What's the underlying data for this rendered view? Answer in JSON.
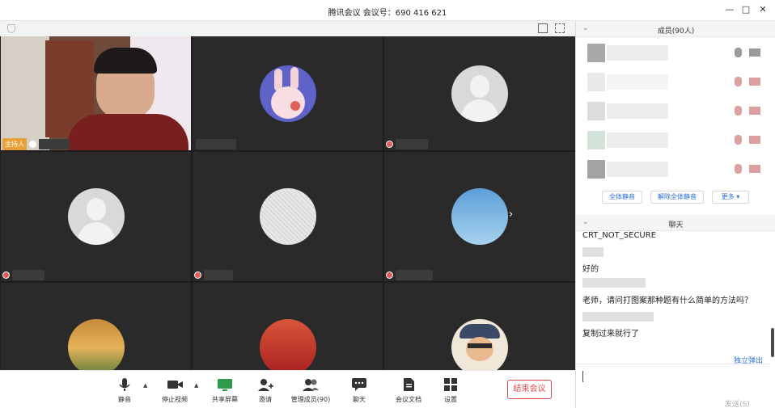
{
  "window": {
    "title": "腾讯会议 会议号：690 416 621",
    "controls": [
      "—",
      "□",
      "✕"
    ]
  },
  "video": {
    "tiles": [
      {
        "kind": "camera",
        "host_tag": "主持人"
      },
      {
        "kind": "bunny"
      },
      {
        "kind": "default"
      },
      {
        "kind": "default"
      },
      {
        "kind": "pattern"
      },
      {
        "kind": "sky"
      },
      {
        "kind": "sunset"
      },
      {
        "kind": "red"
      },
      {
        "kind": "cartoon"
      }
    ],
    "next_page_icon": "chevron-right-icon"
  },
  "toolbar": {
    "mute_label": "静音",
    "stop_video_label": "停止视频",
    "share_screen_label": "共享屏幕",
    "invite_label": "邀请",
    "manage_members_label": "管理成员(90)",
    "chat_label": "聊天",
    "meeting_docs_label": "会议文档",
    "settings_label": "设置",
    "end_meeting_label": "结束会议"
  },
  "members_panel": {
    "title": "成员(90人)",
    "rows": [
      {
        "mic": "on",
        "cam": "on"
      },
      {
        "mic": "muted",
        "cam": "muted"
      },
      {
        "mic": "muted",
        "cam": "muted"
      },
      {
        "mic": "muted",
        "cam": "muted"
      },
      {
        "mic": "muted",
        "cam": "muted"
      }
    ],
    "mute_all_label": "全体静音",
    "unmute_all_label": "解除全体静音",
    "more_label": "更多 ▾"
  },
  "chat_panel": {
    "title": "聊天",
    "messages": [
      {
        "text": "CRT_NOT_SECURE"
      },
      {
        "text": "好的"
      },
      {
        "text": "老师，请问打图案那种题有什么简单的方法吗？"
      },
      {
        "text": "复制过来就行了"
      }
    ],
    "pop_out_label": "独立弹出",
    "send_label": "发送(S)"
  },
  "colors": {
    "accent_blue": "#2a6fd6",
    "end_red": "#e04848",
    "host_orange": "#e9a038"
  }
}
